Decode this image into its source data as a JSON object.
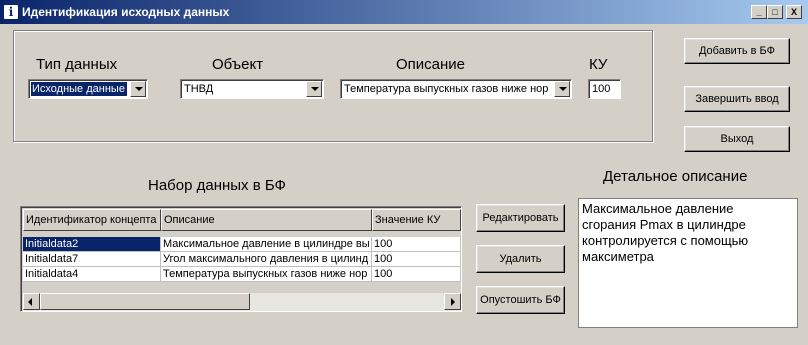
{
  "window": {
    "icon_glyph": "i",
    "title": "Идентификация исходных данных",
    "minimize_glyph": "_",
    "maximize_glyph": "□",
    "close_glyph": "X"
  },
  "form": {
    "data_type": {
      "label": "Тип данных",
      "value": "Исходные данные"
    },
    "object": {
      "label": "Объект",
      "value": "ТНВД"
    },
    "description": {
      "label": "Описание",
      "value": "Температура выпускных газов ниже нор"
    },
    "ku": {
      "label": "КУ",
      "value": "100"
    }
  },
  "buttons": {
    "add": "Добавить в БФ",
    "finish": "Завершить ввод",
    "exit": "Выход",
    "edit": "Редактировать",
    "delete": "Удалить",
    "clear": "Опустошить БФ"
  },
  "dataset": {
    "heading": "Набор данных в БФ",
    "columns": [
      "Идентификатор концепта",
      "Описание",
      "Значение КУ"
    ],
    "rows": [
      {
        "id": "Initialdata2",
        "description": "Максимальное давление в цилиндре вы",
        "ku": "100"
      },
      {
        "id": "Initialdata7",
        "description": "Угол максимального давления в цилинд",
        "ku": "100"
      },
      {
        "id": "Initialdata4",
        "description": "Температура выпускных газов ниже нор",
        "ku": "100"
      }
    ]
  },
  "detail": {
    "heading": "Детальное описание",
    "text": "Максимальное давление сгорания Pmax в цилиндре контролируется с помощью максиметра"
  }
}
